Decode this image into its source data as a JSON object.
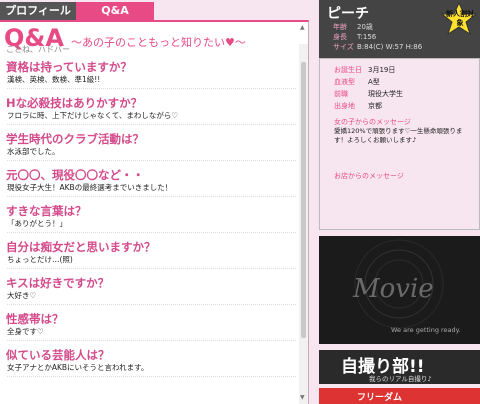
{
  "tabs": {
    "profile": "プロフィール",
    "qa": "Q&A"
  },
  "qa": {
    "logo": "Q&A",
    "subtitle": "〜あの子のこともっと知りたい♥〜",
    "cut_text": "ことね、ハドバー",
    "items": [
      {
        "q": "資格は持っていますか？",
        "a": "漢検、英検、数検、準1級!!"
      },
      {
        "q": "Hな必殺技はありかすか？",
        "a": "フロラに時、上下だけじゃなくて、まわしながら♡"
      },
      {
        "q": "学生時代のクラブ活動は？",
        "a": "水泳部でした。"
      },
      {
        "q": "元〇〇、現役〇〇など・・",
        "a": "現役女子大生！AKBの最終選考までいきました！"
      },
      {
        "q": "すきな言葉は？",
        "a": "「ありがとう！」"
      },
      {
        "q": "自分は痴女だと思いますか？",
        "a": "ちょっとだけ…(照)"
      },
      {
        "q": "キスは好きですか？",
        "a": "大好き♡"
      },
      {
        "q": "性感帯は？",
        "a": "全身です♡"
      },
      {
        "q": "似ている芸能人は？",
        "a": "女子アナとかAKBにいそうと言われます。"
      }
    ]
  },
  "profile": {
    "name": "ピーチ",
    "badge": "新人割対象",
    "stats": [
      {
        "label": "年齢",
        "value": "20歳"
      },
      {
        "label": "身長",
        "value": "T:156"
      },
      {
        "label": "サイズ",
        "value": "B:84(C) W:57 H:86"
      }
    ],
    "details": [
      {
        "label": "お誕生日",
        "value": "3月19日"
      },
      {
        "label": "血液型",
        "value": "A型"
      },
      {
        "label": "前職",
        "value": "現役大学生"
      },
      {
        "label": "出身地",
        "value": "京都"
      }
    ],
    "girl_message_title": "女の子からのメッセージ",
    "girl_message": "愛嬌120%で頑張ります♡一生懸命頑張ります！よろしくお願いします♪",
    "shop_message_title": "お店からのメッセージ"
  },
  "banners": {
    "movie": "Movie",
    "movie_sub": "We are getting ready.",
    "jidori": "自撮り部!!",
    "jidori_sub": "我らのリアル自撮り♪",
    "bottom": "フリーダム"
  }
}
